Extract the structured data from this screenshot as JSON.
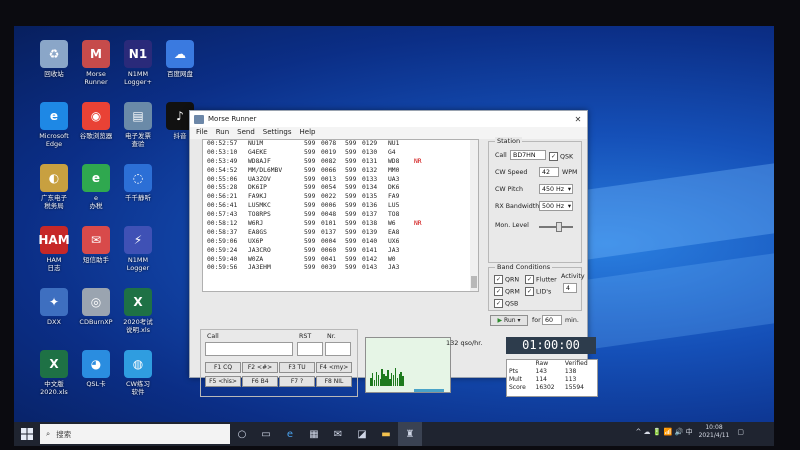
{
  "desktop": {
    "icons": [
      {
        "label": "回收站",
        "glyph": "♻",
        "color": "#8aa6c8"
      },
      {
        "label": "Morse\nRunner",
        "glyph": "M",
        "color": "#c64b4b"
      },
      {
        "label": "N1MM\nLogger+",
        "glyph": "N1",
        "color": "#2a2a7a"
      },
      {
        "label": "百度网盘",
        "glyph": "☁",
        "color": "#3a7ae0"
      },
      {
        "label": "Microsoft\nEdge",
        "glyph": "e",
        "color": "#1e88e5"
      },
      {
        "label": "谷歌浏览器",
        "glyph": "◉",
        "color": "#e94235"
      },
      {
        "label": "电子发票\n查验",
        "glyph": "▤",
        "color": "#6a8aa8"
      },
      {
        "label": "抖音",
        "glyph": "♪",
        "color": "#111111"
      },
      {
        "label": "广东电子\n税务局",
        "glyph": "◐",
        "color": "#c8a040"
      },
      {
        "label": "e\n办税",
        "glyph": "e",
        "color": "#2fa84f"
      },
      {
        "label": "千千静听",
        "glyph": "◌",
        "color": "#2c6fd6"
      },
      {
        "label": "HAM\n日志",
        "glyph": "HAM",
        "color": "#c62828"
      },
      {
        "label": "短信助手",
        "glyph": "✉",
        "color": "#d84a4a"
      },
      {
        "label": "N1MM\nLogger",
        "glyph": "⚡",
        "color": "#3f51b5"
      },
      {
        "label": "DXX",
        "glyph": "✦",
        "color": "#3e6fc0"
      },
      {
        "label": "CDBurnXP",
        "glyph": "◎",
        "color": "#9aa4b0"
      },
      {
        "label": "2020考试\n说明.xls",
        "glyph": "X",
        "color": "#1e7145"
      },
      {
        "label": "中文版\n2020.xls",
        "glyph": "X",
        "color": "#1e7145"
      },
      {
        "label": "CW练习\n软件",
        "glyph": "◍",
        "color": "#2f9de0"
      },
      {
        "label": "QSL卡",
        "glyph": "◕",
        "color": "#2a8de0"
      }
    ]
  },
  "window": {
    "title": "Morse Runner",
    "menu": [
      "File",
      "Run",
      "Send",
      "Settings",
      "Help"
    ],
    "log": [
      {
        "time": "00:52:57",
        "call": "NU1M",
        "rst1": "599",
        "nr1": "0078",
        "rst2": "599",
        "nr2": "0129",
        "pfx": "NU1",
        "err": ""
      },
      {
        "time": "00:53:10",
        "call": "G4EKE",
        "rst1": "599",
        "nr1": "0019",
        "rst2": "599",
        "nr2": "0130",
        "pfx": "G4",
        "err": ""
      },
      {
        "time": "00:53:49",
        "call": "WD8AJF",
        "rst1": "599",
        "nr1": "0082",
        "rst2": "599",
        "nr2": "0131",
        "pfx": "WD8",
        "err": "NR"
      },
      {
        "time": "00:54:52",
        "call": "MM/DL6MBV",
        "rst1": "599",
        "nr1": "0066",
        "rst2": "599",
        "nr2": "0132",
        "pfx": "MM0",
        "err": ""
      },
      {
        "time": "00:55:06",
        "call": "UA3ZOV",
        "rst1": "599",
        "nr1": "0013",
        "rst2": "599",
        "nr2": "0133",
        "pfx": "UA3",
        "err": ""
      },
      {
        "time": "00:55:28",
        "call": "DK6IP",
        "rst1": "599",
        "nr1": "0054",
        "rst2": "599",
        "nr2": "0134",
        "pfx": "DK6",
        "err": ""
      },
      {
        "time": "00:56:21",
        "call": "FA9KJ",
        "rst1": "599",
        "nr1": "0022",
        "rst2": "599",
        "nr2": "0135",
        "pfx": "FA9",
        "err": ""
      },
      {
        "time": "00:56:41",
        "call": "LU5MKC",
        "rst1": "599",
        "nr1": "0006",
        "rst2": "599",
        "nr2": "0136",
        "pfx": "LU5",
        "err": ""
      },
      {
        "time": "00:57:43",
        "call": "TO8RPS",
        "rst1": "599",
        "nr1": "0048",
        "rst2": "599",
        "nr2": "0137",
        "pfx": "TO8",
        "err": ""
      },
      {
        "time": "00:58:12",
        "call": "W6RJ",
        "rst1": "599",
        "nr1": "0101",
        "rst2": "599",
        "nr2": "0138",
        "pfx": "W6",
        "err": "NR"
      },
      {
        "time": "00:58:37",
        "call": "EA8GS",
        "rst1": "599",
        "nr1": "0137",
        "rst2": "599",
        "nr2": "0139",
        "pfx": "EA8",
        "err": ""
      },
      {
        "time": "00:59:06",
        "call": "UX6P",
        "rst1": "599",
        "nr1": "0004",
        "rst2": "599",
        "nr2": "0140",
        "pfx": "UX6",
        "err": ""
      },
      {
        "time": "00:59:24",
        "call": "JA3CRO",
        "rst1": "599",
        "nr1": "0060",
        "rst2": "599",
        "nr2": "0141",
        "pfx": "JA3",
        "err": ""
      },
      {
        "time": "00:59:40",
        "call": "W0ZA",
        "rst1": "599",
        "nr1": "0041",
        "rst2": "599",
        "nr2": "0142",
        "pfx": "W0",
        "err": ""
      },
      {
        "time": "00:59:56",
        "call": "JA3EHM",
        "rst1": "599",
        "nr1": "0039",
        "rst2": "599",
        "nr2": "0143",
        "pfx": "JA3",
        "err": ""
      }
    ],
    "station": {
      "title": "Station",
      "call_label": "Call",
      "call_value": "BD7HN",
      "qsk_label": "QSK",
      "cw_speed_label": "CW Speed",
      "cw_speed_value": "42",
      "wpm_label": "WPM",
      "cw_pitch_label": "CW Pitch",
      "cw_pitch_value": "450 Hz",
      "rx_bw_label": "RX Bandwidth",
      "rx_bw_value": "500 Hz",
      "mon_level_label": "Mon. Level",
      "mon_level": 0.55
    },
    "band": {
      "title": "Band Conditions",
      "qrn": "QRN",
      "qrm": "QRM",
      "qsb": "QSB",
      "flutter": "Flutter",
      "lids": "LID's",
      "activity_label": "Activity",
      "activity_value": "4"
    },
    "run": {
      "button": "Run",
      "for_label": "for",
      "minutes_value": "60",
      "min_label": "min."
    },
    "entry": {
      "call_label": "Call",
      "rst_label": "RST",
      "nr_label": "Nr."
    },
    "fkeys": [
      "F1 CQ",
      "F2 <#>",
      "F3 TU",
      "F4 <my>",
      "F5 <his>",
      "F6 B4",
      "F7 ?",
      "F8 NIL"
    ],
    "rate": "132 qso/hr.",
    "clock": "01:00:00",
    "score": {
      "headers": [
        "",
        "Raw",
        "Verified"
      ],
      "rows": [
        [
          "Pts",
          "143",
          "138"
        ],
        [
          "Mult",
          "114",
          "113"
        ],
        [
          "Score",
          "16302",
          "15594"
        ]
      ]
    },
    "bandmap_levels": [
      0.35,
      0.55,
      0.25,
      0.6,
      0.45,
      0.3,
      0.7,
      0.5,
      0.4,
      0.65,
      0.3,
      0.55,
      0.45,
      0.75,
      0.35,
      0.5,
      0.6,
      0.4
    ]
  },
  "taskbar": {
    "search_placeholder": "搜索",
    "time": "10:08",
    "date": "2021/4/11",
    "tray_text": "^ ☁ 🔋 📶 🔊 中"
  }
}
